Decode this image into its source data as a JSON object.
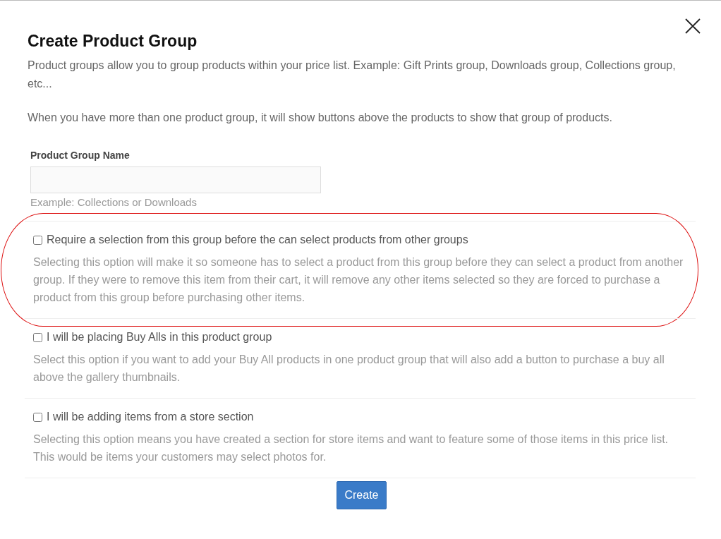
{
  "dialog": {
    "title": "Create Product Group",
    "intro": [
      "Product groups allow you to group products within your price list. Example: Gift Prints group, Downloads group, Collections group, etc...",
      "When you have more than one product group, it will show buttons above the products to show that group of products."
    ]
  },
  "name_field": {
    "label": "Product Group Name",
    "help": "Example: Collections or Downloads"
  },
  "options": [
    {
      "label": "Require a selection from this group before the can select products from other groups",
      "description": "Selecting this option will make it so someone has to select a product from this group before they can select a product from another group. If they were to remove this item from their cart, it will remove any other items selected so they are forced to purchase a product from this group before purchasing other items.",
      "checked": false,
      "circled": true
    },
    {
      "label": "I will be placing Buy Alls in this product group",
      "description": "Select this option if you want to add your Buy All products in one product group that will also add a button to purchase a buy all above the gallery thumbnails.",
      "checked": false,
      "circled": false
    },
    {
      "label": "I will be adding items from a store section",
      "description": "Selecting this option means you have created a section for store items and want to feature some of those items in this price list. This would be items your customers may select photos for.",
      "checked": false,
      "circled": false
    }
  ],
  "buttons": [
    {
      "label": "Create"
    }
  ]
}
